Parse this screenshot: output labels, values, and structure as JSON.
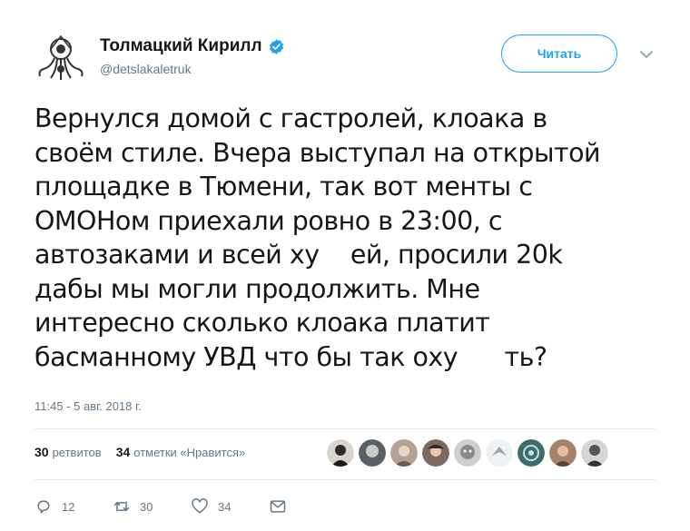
{
  "author": {
    "display_name": "Толмацкий Кирилл",
    "handle": "@detslakaletruk",
    "verified": true
  },
  "follow_button": {
    "label": "Читать"
  },
  "tweet": {
    "lines": [
      "Вернулся домой с гастролей, клоака в",
      "своём стиле. Вчера выступал на открытой",
      "площадке в Тюмени, так вот менты с",
      "ОМОНом приехали ровно в 23:00, с",
      "автозаками и всей ху    ей, просили 20k",
      "дабы мы могли продолжить. Мне",
      "интересно сколько клоака платит",
      "басманному УВД что бы так оху      ть?"
    ],
    "timestamp": "11:45 - 5 авг. 2018 г."
  },
  "stats": {
    "retweets_count": "30",
    "retweets_label": "ретвитов",
    "likes_count": "34",
    "likes_label": "отметки «Нравится»"
  },
  "actions": {
    "reply_count": "12",
    "retweet_count": "30",
    "like_count": "34"
  },
  "colors": {
    "accent": "#1da1f2",
    "muted": "#657786",
    "text": "#14171a",
    "divider": "#e6ecf0"
  }
}
